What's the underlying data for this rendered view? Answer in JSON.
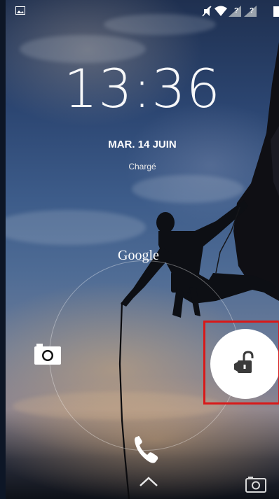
{
  "status_bar": {
    "left_icon": "picture-icon",
    "right_icons": [
      "mute-icon",
      "wifi-icon",
      "signal-icon",
      "signal-icon-2",
      "battery-icon"
    ],
    "signal_mark_1": "?",
    "signal_mark_2": "?"
  },
  "lockscreen": {
    "time": "13:36",
    "date": "MAR. 14 JUIN",
    "charge_status": "Chargé",
    "google_label": "Google"
  },
  "targets": {
    "camera_left": "camera-icon",
    "phone_bottom": "phone-icon",
    "unlock_right": "unlock-icon",
    "swipe_up": "chevron-up-icon",
    "camera_corner": "camera-icon"
  },
  "colors": {
    "highlight": "#d81919",
    "handle": "#ffffff"
  }
}
